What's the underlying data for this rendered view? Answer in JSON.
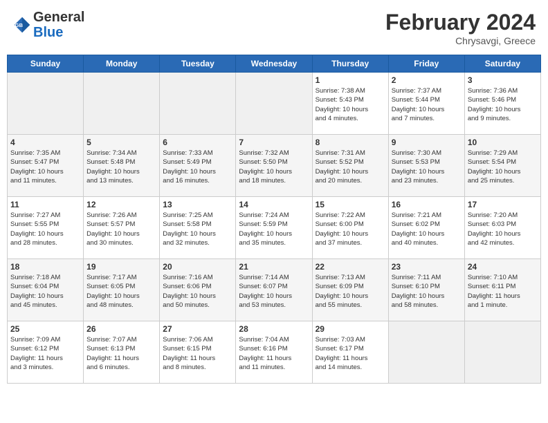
{
  "header": {
    "logo_text_general": "General",
    "logo_text_blue": "Blue",
    "title": "February 2024",
    "subtitle": "Chrysavgi, Greece"
  },
  "days_of_week": [
    "Sunday",
    "Monday",
    "Tuesday",
    "Wednesday",
    "Thursday",
    "Friday",
    "Saturday"
  ],
  "weeks": [
    [
      {
        "day": "",
        "info": ""
      },
      {
        "day": "",
        "info": ""
      },
      {
        "day": "",
        "info": ""
      },
      {
        "day": "",
        "info": ""
      },
      {
        "day": "1",
        "info": "Sunrise: 7:38 AM\nSunset: 5:43 PM\nDaylight: 10 hours\nand 4 minutes."
      },
      {
        "day": "2",
        "info": "Sunrise: 7:37 AM\nSunset: 5:44 PM\nDaylight: 10 hours\nand 7 minutes."
      },
      {
        "day": "3",
        "info": "Sunrise: 7:36 AM\nSunset: 5:46 PM\nDaylight: 10 hours\nand 9 minutes."
      }
    ],
    [
      {
        "day": "4",
        "info": "Sunrise: 7:35 AM\nSunset: 5:47 PM\nDaylight: 10 hours\nand 11 minutes."
      },
      {
        "day": "5",
        "info": "Sunrise: 7:34 AM\nSunset: 5:48 PM\nDaylight: 10 hours\nand 13 minutes."
      },
      {
        "day": "6",
        "info": "Sunrise: 7:33 AM\nSunset: 5:49 PM\nDaylight: 10 hours\nand 16 minutes."
      },
      {
        "day": "7",
        "info": "Sunrise: 7:32 AM\nSunset: 5:50 PM\nDaylight: 10 hours\nand 18 minutes."
      },
      {
        "day": "8",
        "info": "Sunrise: 7:31 AM\nSunset: 5:52 PM\nDaylight: 10 hours\nand 20 minutes."
      },
      {
        "day": "9",
        "info": "Sunrise: 7:30 AM\nSunset: 5:53 PM\nDaylight: 10 hours\nand 23 minutes."
      },
      {
        "day": "10",
        "info": "Sunrise: 7:29 AM\nSunset: 5:54 PM\nDaylight: 10 hours\nand 25 minutes."
      }
    ],
    [
      {
        "day": "11",
        "info": "Sunrise: 7:27 AM\nSunset: 5:55 PM\nDaylight: 10 hours\nand 28 minutes."
      },
      {
        "day": "12",
        "info": "Sunrise: 7:26 AM\nSunset: 5:57 PM\nDaylight: 10 hours\nand 30 minutes."
      },
      {
        "day": "13",
        "info": "Sunrise: 7:25 AM\nSunset: 5:58 PM\nDaylight: 10 hours\nand 32 minutes."
      },
      {
        "day": "14",
        "info": "Sunrise: 7:24 AM\nSunset: 5:59 PM\nDaylight: 10 hours\nand 35 minutes."
      },
      {
        "day": "15",
        "info": "Sunrise: 7:22 AM\nSunset: 6:00 PM\nDaylight: 10 hours\nand 37 minutes."
      },
      {
        "day": "16",
        "info": "Sunrise: 7:21 AM\nSunset: 6:02 PM\nDaylight: 10 hours\nand 40 minutes."
      },
      {
        "day": "17",
        "info": "Sunrise: 7:20 AM\nSunset: 6:03 PM\nDaylight: 10 hours\nand 42 minutes."
      }
    ],
    [
      {
        "day": "18",
        "info": "Sunrise: 7:18 AM\nSunset: 6:04 PM\nDaylight: 10 hours\nand 45 minutes."
      },
      {
        "day": "19",
        "info": "Sunrise: 7:17 AM\nSunset: 6:05 PM\nDaylight: 10 hours\nand 48 minutes."
      },
      {
        "day": "20",
        "info": "Sunrise: 7:16 AM\nSunset: 6:06 PM\nDaylight: 10 hours\nand 50 minutes."
      },
      {
        "day": "21",
        "info": "Sunrise: 7:14 AM\nSunset: 6:07 PM\nDaylight: 10 hours\nand 53 minutes."
      },
      {
        "day": "22",
        "info": "Sunrise: 7:13 AM\nSunset: 6:09 PM\nDaylight: 10 hours\nand 55 minutes."
      },
      {
        "day": "23",
        "info": "Sunrise: 7:11 AM\nSunset: 6:10 PM\nDaylight: 10 hours\nand 58 minutes."
      },
      {
        "day": "24",
        "info": "Sunrise: 7:10 AM\nSunset: 6:11 PM\nDaylight: 11 hours\nand 1 minute."
      }
    ],
    [
      {
        "day": "25",
        "info": "Sunrise: 7:09 AM\nSunset: 6:12 PM\nDaylight: 11 hours\nand 3 minutes."
      },
      {
        "day": "26",
        "info": "Sunrise: 7:07 AM\nSunset: 6:13 PM\nDaylight: 11 hours\nand 6 minutes."
      },
      {
        "day": "27",
        "info": "Sunrise: 7:06 AM\nSunset: 6:15 PM\nDaylight: 11 hours\nand 8 minutes."
      },
      {
        "day": "28",
        "info": "Sunrise: 7:04 AM\nSunset: 6:16 PM\nDaylight: 11 hours\nand 11 minutes."
      },
      {
        "day": "29",
        "info": "Sunrise: 7:03 AM\nSunset: 6:17 PM\nDaylight: 11 hours\nand 14 minutes."
      },
      {
        "day": "",
        "info": ""
      },
      {
        "day": "",
        "info": ""
      }
    ]
  ]
}
